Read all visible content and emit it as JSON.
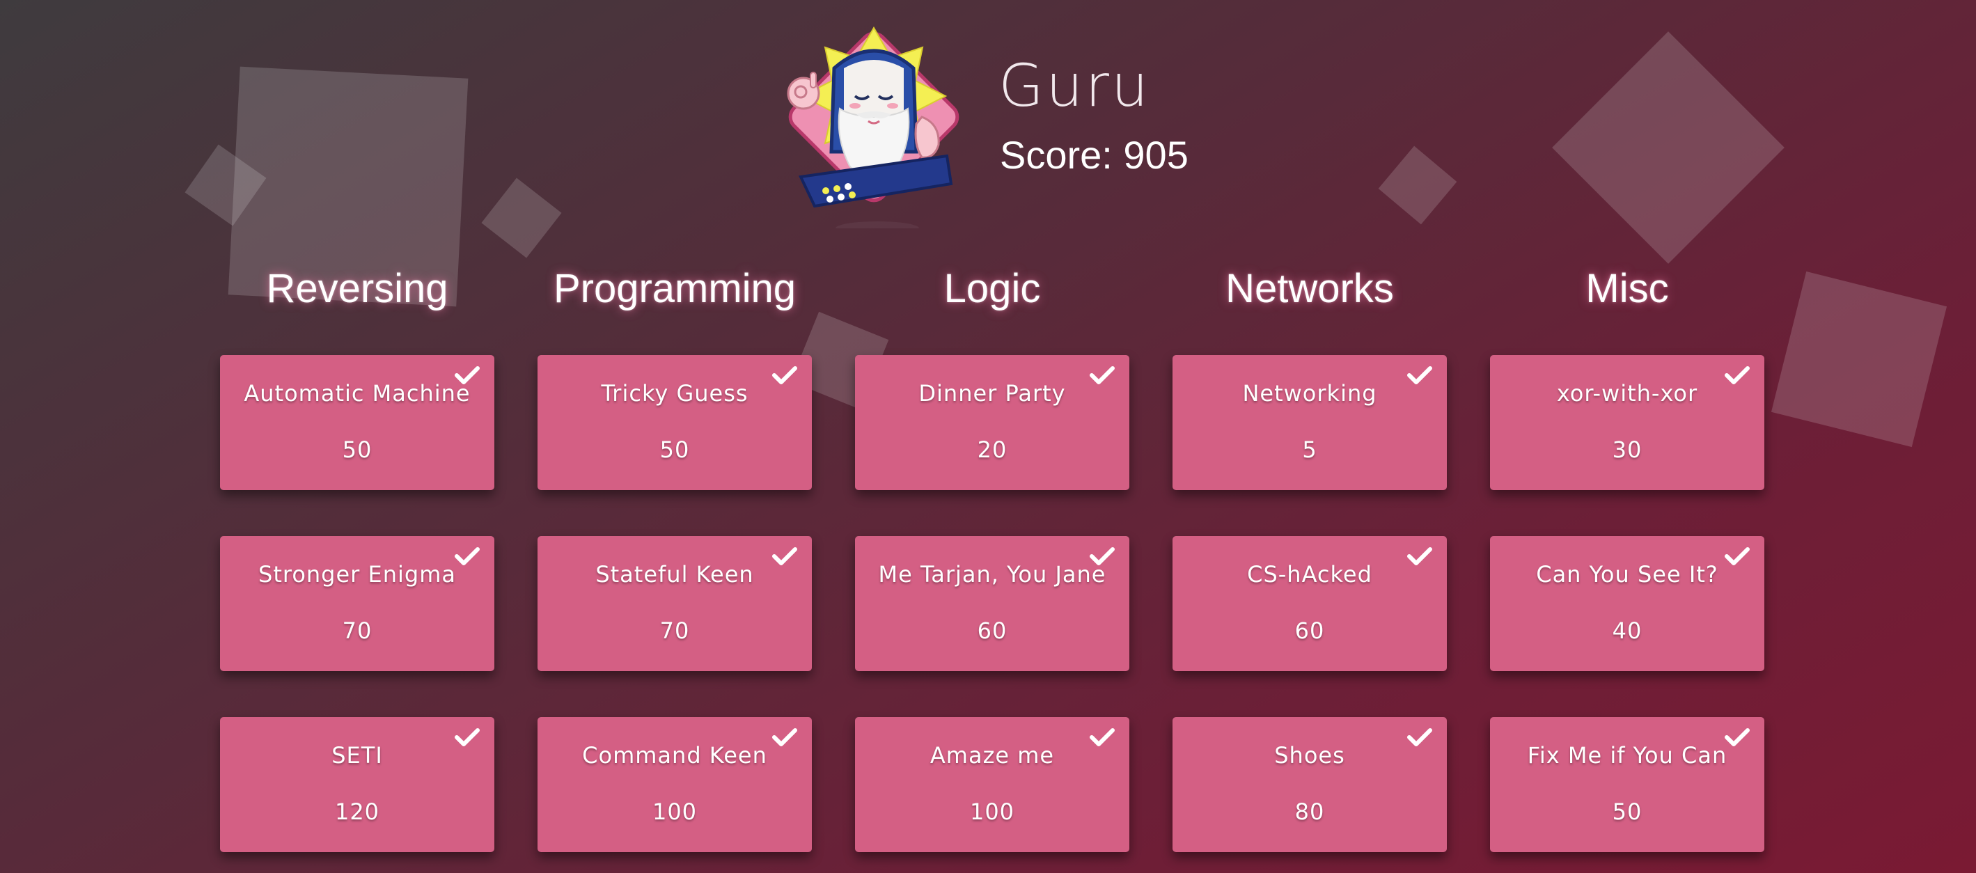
{
  "header": {
    "user_name": "Guru",
    "score_text": "Score: 905",
    "avatar_icon": "guru-mascot-icon"
  },
  "colors": {
    "tile": "#d45f84",
    "background_start": "#3f3b3e",
    "background_end": "#7a1a33"
  },
  "categories": [
    {
      "title": "Reversing",
      "challenges": [
        {
          "name": "Automatic Machine",
          "points": "50",
          "solved": true
        },
        {
          "name": "Stronger Enigma",
          "points": "70",
          "solved": true
        },
        {
          "name": "SETI",
          "points": "120",
          "solved": true
        }
      ]
    },
    {
      "title": "Programming",
      "challenges": [
        {
          "name": "Tricky Guess",
          "points": "50",
          "solved": true
        },
        {
          "name": "Stateful Keen",
          "points": "70",
          "solved": true
        },
        {
          "name": "Command Keen",
          "points": "100",
          "solved": true
        }
      ]
    },
    {
      "title": "Logic",
      "challenges": [
        {
          "name": "Dinner Party",
          "points": "20",
          "solved": true
        },
        {
          "name": "Me Tarjan, You Jane",
          "points": "60",
          "solved": true
        },
        {
          "name": "Amaze me",
          "points": "100",
          "solved": true
        }
      ]
    },
    {
      "title": "Networks",
      "challenges": [
        {
          "name": "Networking",
          "points": "5",
          "solved": true
        },
        {
          "name": "CS-hAcked",
          "points": "60",
          "solved": true
        },
        {
          "name": "Shoes",
          "points": "80",
          "solved": true
        }
      ]
    },
    {
      "title": "Misc",
      "challenges": [
        {
          "name": "xor-with-xor",
          "points": "30",
          "solved": true
        },
        {
          "name": "Can You See It?",
          "points": "40",
          "solved": true
        },
        {
          "name": "Fix Me if You Can",
          "points": "50",
          "solved": true
        }
      ]
    }
  ]
}
